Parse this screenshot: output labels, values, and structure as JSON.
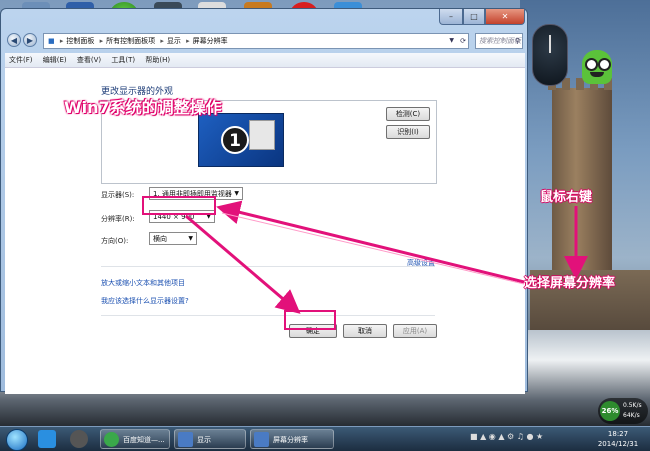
{
  "window": {
    "min": "–",
    "max": "□",
    "close": "✕"
  },
  "address": {
    "parts": [
      "控制面板",
      "所有控制面板项",
      "显示",
      "屏幕分辨率"
    ],
    "search_placeholder": "搜索控制面板"
  },
  "menu": [
    "文件(F)",
    "编辑(E)",
    "查看(V)",
    "工具(T)",
    "帮助(H)"
  ],
  "content": {
    "heading": "更改显示器的外观",
    "monitor_number": "1",
    "detect": "检测(C)",
    "identify": "识别(I)",
    "display_label": "显示器(S):",
    "display_value": "1. 通用非即插即用监视器",
    "resolution_label": "分辨率(R):",
    "resolution_value": "1440 × 900",
    "orientation_label": "方向(O):",
    "orientation_value": "横向",
    "advanced_link": "高级设置",
    "link1": "放大或缩小文本和其他项目",
    "link2": "我应该选择什么显示器设置?",
    "ok": "确定",
    "cancel": "取消",
    "apply": "应用(A)"
  },
  "annotations": {
    "title": "Win7系统的调整操作",
    "right_click": "鼠标右键",
    "choose_resolution": "选择屏幕分辨率",
    "color": "#e2117a"
  },
  "gadgets": {
    "net_percent": "26%",
    "upload": "0.5K/s",
    "download": "64K/s"
  },
  "taskbar": {
    "tasks": [
      "百度知道—...",
      "显示",
      "屏幕分辨率"
    ],
    "time": "18:27",
    "date": "2014/12/31"
  }
}
